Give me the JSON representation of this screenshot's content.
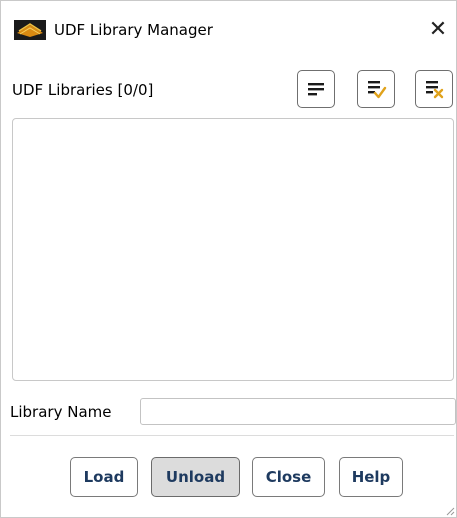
{
  "window": {
    "title": "UDF Library Manager",
    "close_glyph": "✕",
    "app_icon": "fluent-logo-icon"
  },
  "libraries": {
    "label": "UDF Libraries",
    "count": "[0/0]",
    "items": [],
    "toolbar": [
      {
        "name": "select-all-button",
        "icon": "list-lines-icon"
      },
      {
        "name": "select-checked-button",
        "icon": "list-check-icon"
      },
      {
        "name": "deselect-all-button",
        "icon": "list-x-icon"
      }
    ]
  },
  "library_name": {
    "label": "Library Name",
    "value": ""
  },
  "actions": {
    "load": "Load",
    "unload": "Unload",
    "close": "Close",
    "help": "Help"
  },
  "colors": {
    "button_text": "#1e3a5f",
    "check_accent": "#e0a21b",
    "x_accent": "#e0a21b",
    "pressed_bg": "#dcdcdc"
  }
}
